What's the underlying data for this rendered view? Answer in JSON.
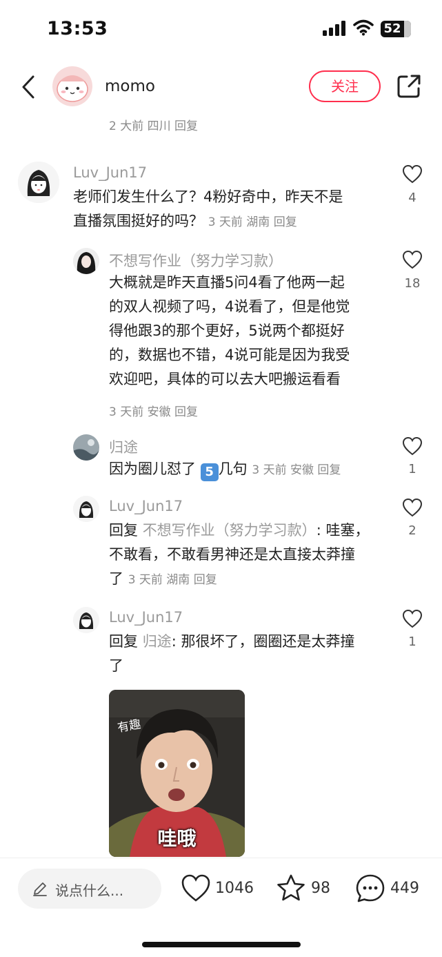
{
  "status": {
    "time": "13:53",
    "battery": "52"
  },
  "header": {
    "author": "momo",
    "follow_label": "关注"
  },
  "prev_meta": "2 大前  四川  回复",
  "comments": [
    {
      "user": "Luv_Jun17",
      "text_line1": "老师们发生什么了？4粉好奇中，昨天不是",
      "text_line2": "直播氛围挺好的吗？",
      "meta": "3 天前  湖南  回复",
      "likes": "4"
    },
    {
      "user": "不想写作业（努力学习款）",
      "text_lines": [
        "大概就是昨天直播5问4看了他两一起",
        "的双人视频了吗，4说看了，但是他觉",
        "得他跟3的那个更好，5说两个都挺好",
        "的，数据也不错，4说可能是因为我受",
        "欢迎吧，具体的可以去大吧搬运看看"
      ],
      "meta": "3 天前  安徽  回复",
      "likes": "18"
    },
    {
      "user": "归途",
      "text_before": "因为圈儿怼了",
      "badge": "5",
      "text_after": "几句",
      "meta": "3 天前  安徽  回复",
      "likes": "1"
    },
    {
      "user": "Luv_Jun17",
      "reply_prefix": "回复",
      "reply_to": "不想写作业（努力学习款）",
      "text_line1": ": 哇塞，",
      "text_line2": "不敢看，不敢看男神还是太直接太莽撞",
      "text_line3": "了",
      "meta": "3 天前  湖南  回复",
      "likes": "2"
    },
    {
      "user": "Luv_Jun17",
      "reply_prefix": "回复",
      "reply_to": "归途",
      "text_line1": ": 那很坏了，圈圈还是太莽撞",
      "text_line2": "了",
      "likes": "1",
      "sticker_top": "有趣",
      "sticker_caption": "哇哦"
    }
  ],
  "bottom": {
    "placeholder": "说点什么...",
    "likes": "1046",
    "stars": "98",
    "comments": "449"
  },
  "colors": {
    "accent": "#ff2e4d",
    "muted": "#8a8a8a"
  }
}
